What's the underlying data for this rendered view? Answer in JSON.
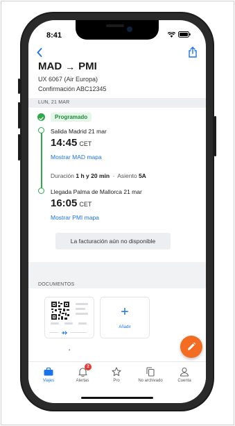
{
  "status_bar": {
    "time": "8:41"
  },
  "header": {
    "origin": "MAD",
    "destination": "PMI",
    "route_arrow": "→",
    "flight": "UX 6067 (Air Europa)",
    "confirmation": "Confirmación ABC12345"
  },
  "date_label": "LUN, 21 MAR",
  "status": {
    "label": "Programado",
    "color": "#2eaa4a"
  },
  "departure": {
    "label": "Salida Madrid 21 mar",
    "time": "14:45",
    "tz": "CET",
    "map_link": "Mostrar MAD mapa"
  },
  "duration": {
    "prefix": "Duración",
    "value": "1 h y 20 min",
    "separator": "·",
    "seat_prefix": "Asiento",
    "seat": "5A"
  },
  "arrival": {
    "label": "Llegada Palma de Mallorca 21 mar",
    "time": "16:05",
    "tz": "CET",
    "map_link": "Mostrar PMI mapa"
  },
  "checkin_button": "La facturación aún no disponible",
  "documents": {
    "heading": "DOCUMENTOS",
    "add_label": "Añadir",
    "add_symbol": "+",
    "more_dots": "•"
  },
  "tabs": [
    {
      "label": "Viajes",
      "active": true
    },
    {
      "label": "Alertas",
      "badge": "2"
    },
    {
      "label": "Pro"
    },
    {
      "label": "No archivado"
    },
    {
      "label": "Cuenta"
    }
  ],
  "colors": {
    "accent": "#1a73e8",
    "fab": "#f36c21",
    "badge": "#e53935"
  }
}
